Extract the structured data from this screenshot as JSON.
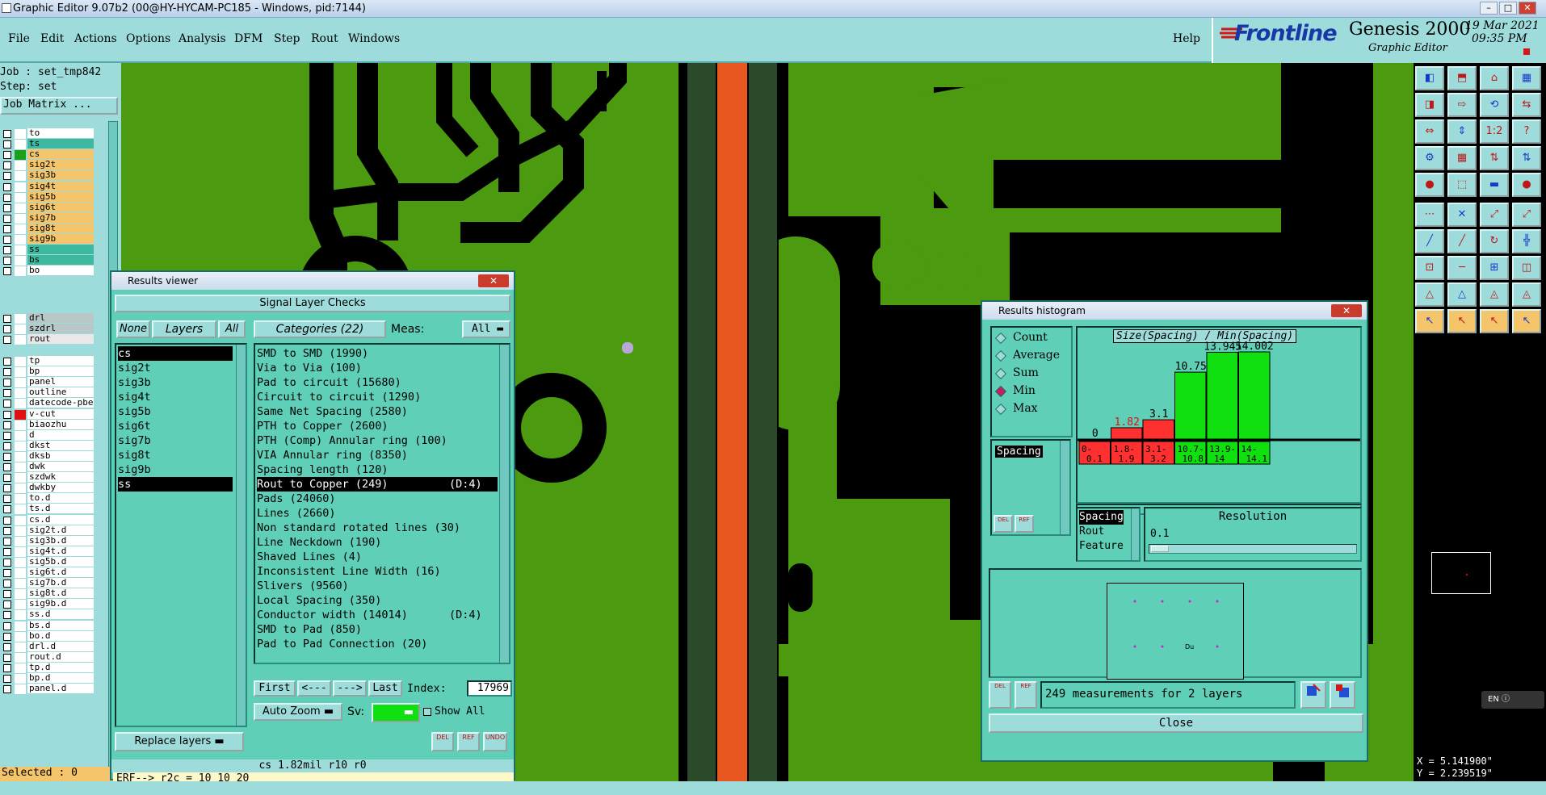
{
  "window": {
    "title": "Graphic Editor 9.07b2 (00@HY-HYCAM-PC185 - Windows, pid:7144)"
  },
  "menu": [
    "File",
    "Edit",
    "Actions",
    "Options",
    "Analysis",
    "DFM",
    "Step",
    "Rout",
    "Windows"
  ],
  "help_label": "Help",
  "brand": {
    "logo": "Frontline",
    "product": "Genesis 2000",
    "subtitle": "Graphic Editor",
    "date": "19 Mar 2021",
    "time": "09:35 PM"
  },
  "job": {
    "job_line": "Job : set_tmp842",
    "step_line": "Step: set",
    "matrix_button": "Job Matrix ..."
  },
  "layers": [
    {
      "name": "to",
      "bg": "#ffffff",
      "sw": "#ffffff"
    },
    {
      "name": "ts",
      "bg": "#3fb8a0",
      "sw": "#ffffff"
    },
    {
      "name": "cs",
      "bg": "#f4c56a",
      "sw": "#1aa01a"
    },
    {
      "name": "sig2t",
      "bg": "#f4c56a",
      "sw": "#ffffff"
    },
    {
      "name": "sig3b",
      "bg": "#f4c56a",
      "sw": "#ffffff"
    },
    {
      "name": "sig4t",
      "bg": "#f4c56a",
      "sw": "#ffffff"
    },
    {
      "name": "sig5b",
      "bg": "#f4c56a",
      "sw": "#ffffff"
    },
    {
      "name": "sig6t",
      "bg": "#f4c56a",
      "sw": "#ffffff"
    },
    {
      "name": "sig7b",
      "bg": "#f4c56a",
      "sw": "#ffffff"
    },
    {
      "name": "sig8t",
      "bg": "#f4c56a",
      "sw": "#ffffff"
    },
    {
      "name": "sig9b",
      "bg": "#f4c56a",
      "sw": "#ffffff"
    },
    {
      "name": "ss",
      "bg": "#3fb8a0",
      "sw": "#ffffff"
    },
    {
      "name": "bs",
      "bg": "#3fb8a0",
      "sw": "#ffffff"
    },
    {
      "name": "bo",
      "bg": "#ffffff",
      "sw": "#ffffff"
    }
  ],
  "layers2": [
    {
      "name": "drl",
      "bg": "#b8c8c8"
    },
    {
      "name": "szdrl",
      "bg": "#b8c8c8"
    },
    {
      "name": "rout",
      "bg": "#e8e8e8"
    }
  ],
  "layers3": [
    "tp",
    "bp",
    "panel",
    "outline",
    "datecode-pbe",
    "v-cut",
    "biaozhu",
    "d",
    "dkst",
    "dksb",
    "dwk",
    "szdwk",
    "dwkby",
    "to.d",
    "ts.d",
    "cs.d",
    "sig2t.d",
    "sig3b.d",
    "sig4t.d",
    "sig5b.d",
    "sig6t.d",
    "sig7b.d",
    "sig8t.d",
    "sig9b.d",
    "ss.d",
    "bs.d",
    "bo.d",
    "drl.d",
    "rout.d",
    "tp.d",
    "bp.d",
    "panel.d"
  ],
  "selected": "Selected : 0",
  "results_viewer": {
    "title": "Results viewer",
    "header": "Signal Layer Checks",
    "none_btn": "None",
    "layers_btn": "Layers",
    "all_btn": "All",
    "layers": [
      "cs",
      "sig2t",
      "sig3b",
      "sig4t",
      "sig5b",
      "sig6t",
      "sig7b",
      "sig8t",
      "sig9b",
      "ss"
    ],
    "categories_label": "Categories (22)",
    "meas_label": "Meas:",
    "meas_value": "All",
    "categories": [
      "SMD to SMD (1990)",
      "Via to Via (100)",
      "Pad to circuit (15680)",
      "Circuit to circuit (1290)",
      "Same Net Spacing (2580)",
      "PTH to Copper (2600)",
      "PTH (Comp) Annular ring (100)",
      "VIA Annular ring (8350)",
      "Spacing length (120)",
      "Rout to Copper (249)",
      "Pads (24060)",
      "Lines (2660)",
      "Non standard rotated lines (30)",
      "Line Neckdown (190)",
      "Shaved Lines (4)",
      "Inconsistent Line Width (16)",
      "Slivers (9560)",
      "Local Spacing (350)",
      "Conductor width (14014)",
      "SMD to Pad (850)",
      "Pad to Pad Connection (20)"
    ],
    "rout_tag": "(D:4)",
    "conductor_tag": "(D:4)",
    "first": "First",
    "prev": "<---",
    "next": "--->",
    "last": "Last",
    "index_label": "Index:",
    "index_value": "17969",
    "auto_zoom": "Auto Zoom",
    "sv_label": "Sv:",
    "replace_layers": "Replace layers",
    "del": "DEL",
    "ref": "REF",
    "undo": "UNDO",
    "status_line": "cs 1.82mil  r10  r0",
    "erf_line": "ERF--> r2c = 10 10 20",
    "show_all": "Show All"
  },
  "histogram": {
    "title": "Results histogram",
    "chart_title": "Size(Spacing) / Min(Spacing)",
    "modes": [
      "Count",
      "Average",
      "Sum",
      "Min",
      "Max"
    ],
    "selected_mode": "Min",
    "left_list_selected": "Spacing",
    "bars": [
      {
        "label": "0",
        "value": 0,
        "color": "#ff3030",
        "range": "0-\n0.1"
      },
      {
        "label": "1.82",
        "value": 1.82,
        "color": "#ff3030",
        "range": "1.8-\n1.9"
      },
      {
        "label": "3.1",
        "value": 3.1,
        "color": "#ff3030",
        "range": "3.1-\n3.2"
      },
      {
        "label": "10.75",
        "value": 10.75,
        "color": "#10e010",
        "range": "10.7-\n10.8"
      },
      {
        "label": "13.945",
        "value": 13.945,
        "color": "#10e010",
        "range": "13.9-\n14"
      },
      {
        "label": "14.002",
        "value": 14.002,
        "color": "#10e010",
        "range": "14-\n14.1"
      }
    ],
    "fields": [
      "Spacing",
      "Rout",
      "Feature"
    ],
    "resolution_label": "Resolution",
    "resolution_value": "0.1",
    "footer": "249 measurements for 2 layers",
    "close": "Close"
  },
  "coords": {
    "x": "X = 5.141900\"",
    "y": "Y = 2.239519\""
  },
  "lang_badge": "EN"
}
